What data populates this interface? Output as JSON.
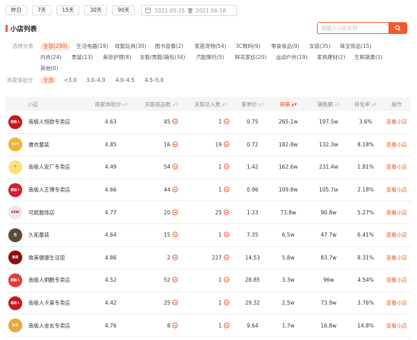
{
  "datebar": {
    "buttons": [
      "昨日",
      "7天",
      "15天",
      "30天",
      "90天"
    ],
    "start_date": "2021-05-25",
    "range_sep": "至",
    "end_date": "2021-06-18"
  },
  "section": {
    "title": "小店列表",
    "search_placeholder": "请输入小店名称"
  },
  "filters": {
    "category_label": "选择分类",
    "categories_row1": [
      "全部(299)",
      "生活电器(19)",
      "母婴玩具(30)",
      "图书音像(2)",
      "家居宠物(54)",
      "3C数码(9)",
      "零食食品(9)",
      "女装(35)",
      "珠宝饰品(15)"
    ],
    "categories_row2": [
      "内衣(24)",
      "男装(13)",
      "美妆护理(8)",
      "女鞋/男鞋/箱包(34)",
      "汽配摩托(5)",
      "鲜花家纺(20)",
      "运动户外(19)",
      "家具建材(2)",
      "生鲜蔬果(1)"
    ],
    "categories_row3": [
      "其他(0)"
    ],
    "score_label": "商家体验分",
    "scores": [
      "全部",
      "<3.0",
      "3.0–4.0",
      "4.0–4.5",
      "4.5–5.0"
    ]
  },
  "table": {
    "headers": {
      "store": "小店",
      "score": "商家体验分",
      "goods": "关联商品数",
      "talent": "关联达人数",
      "price": "客单价",
      "sales": "销量",
      "amount": "销售额",
      "conv": "转化率",
      "op": "操作"
    },
    "rows": [
      {
        "name": "南极人恒欧专卖店",
        "score": "4.63",
        "goods": "45",
        "talent": "1",
        "price": "0.75",
        "sales": "265.1w",
        "amount": "197.5w",
        "conv": "3.6%",
        "op": "查看小店",
        "logo_text": "南极人",
        "logo_color": "#c8161d"
      },
      {
        "name": "雅衣童装",
        "score": "4.85",
        "goods": "16",
        "talent": "19",
        "price": "0.72",
        "sales": "182.8w",
        "amount": "132.3w",
        "conv": "8.18%",
        "op": "查看小店",
        "logo_text": "YAYI",
        "logo_color": "#f2b134"
      },
      {
        "name": "南极人安厂专卖店",
        "score": "4.49",
        "goods": "54",
        "talent": "1",
        "price": "1.42",
        "sales": "162.6w",
        "amount": "231.4w",
        "conv": "1.81%",
        "op": "查看小店",
        "logo_text": "☀",
        "logo_color": "#f7e27a"
      },
      {
        "name": "南极人正博专卖店",
        "score": "4.66",
        "goods": "44",
        "talent": "1",
        "price": "0.96",
        "sales": "109.8w",
        "amount": "105.7w",
        "conv": "2.18%",
        "op": "查看小店",
        "logo_text": "南极人",
        "logo_color": "#d0202a"
      },
      {
        "name": "可妮服饰店",
        "score": "4.77",
        "goods": "20",
        "talent": "25",
        "price": "1.23",
        "sales": "73.8w",
        "amount": "90.8w",
        "conv": "5.27%",
        "op": "查看小店",
        "logo_text": "KENI",
        "logo_color": "#e9e9e9"
      },
      {
        "name": "久拓童装",
        "score": "4.64",
        "goods": "15",
        "talent": "1",
        "price": "7.35",
        "sales": "6.5w",
        "amount": "47.7w",
        "conv": "6.41%",
        "op": "查看小店",
        "logo_text": "芭",
        "logo_color": "#5a4a3a"
      },
      {
        "name": "致美健康生活馆",
        "score": "4.86",
        "goods": "2",
        "talent": "227",
        "price": "14.53",
        "sales": "5.8w",
        "amount": "83.7w",
        "conv": "8.31%",
        "op": "查看小店",
        "logo_text": "致美",
        "logo_color": "#8b0f0f"
      },
      {
        "name": "南极人炯鹏专卖店",
        "score": "4.52",
        "goods": "52",
        "talent": "1",
        "price": "28.85",
        "sales": "3.3w",
        "amount": "96w",
        "conv": "4.54%",
        "op": "查看小店",
        "logo_text": "南极人",
        "logo_color": "#e23b3b"
      },
      {
        "name": "南极人卡莱专卖店",
        "score": "4.42",
        "goods": "25",
        "talent": "1",
        "price": "29.32",
        "sales": "2.5w",
        "amount": "73.9w",
        "conv": "3.76%",
        "op": "查看小店",
        "logo_text": "南极人",
        "logo_color": "#c8161d"
      },
      {
        "name": "南极人金玄专卖店",
        "score": "4.76",
        "goods": "8",
        "talent": "1",
        "price": "9.64",
        "sales": "1.7w",
        "amount": "16.8w",
        "conv": "14.8%",
        "op": "查看小店",
        "logo_text": "金玄",
        "logo_color": "#e8a93b"
      }
    ]
  },
  "colors": {
    "accent": "#f05a2b",
    "header_bg": "#f5f5f5"
  }
}
